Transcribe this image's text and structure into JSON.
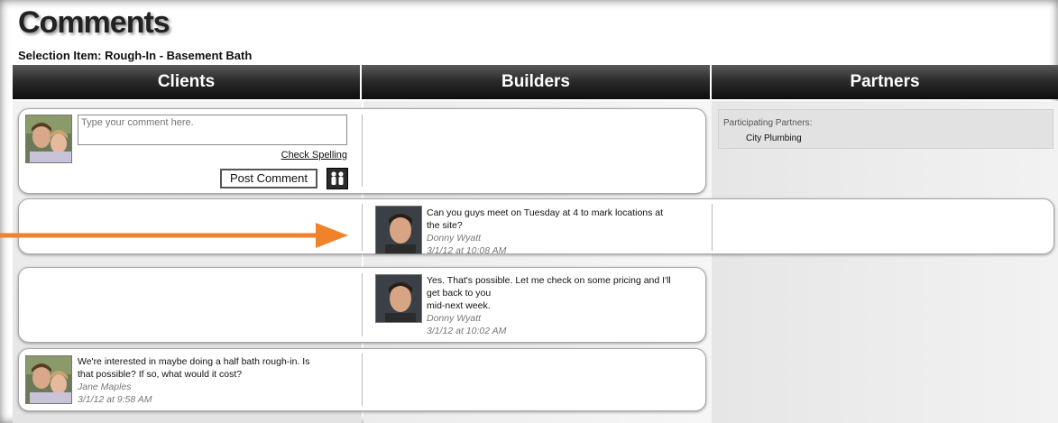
{
  "page": {
    "title": "Comments",
    "selection_item": "Selection Item: Rough-In - Basement Bath"
  },
  "columns": {
    "clients": "Clients",
    "builders": "Builders",
    "partners": "Partners"
  },
  "composer": {
    "placeholder": "Type your comment here.",
    "check_spelling": "Check Spelling",
    "post_comment": "Post Comment",
    "participants_icon": "people-icon"
  },
  "partners": {
    "label": "Participating Partners:",
    "names": [
      "City Plumbing"
    ]
  },
  "comments": [
    {
      "column": "builders",
      "text_lines": [
        "Can you guys meet on Tuesday at 4 to mark locations at",
        "the site?"
      ],
      "author": "Donny Wyatt",
      "timestamp": "3/1/12 at 10:08 AM"
    },
    {
      "column": "builders",
      "text_lines": [
        "Yes. That's possible. Let me check on some pricing and I'll",
        "get back to you",
        "mid-next week."
      ],
      "author": "Donny Wyatt",
      "timestamp": "3/1/12 at 10:02 AM"
    },
    {
      "column": "clients",
      "text_lines": [
        "We're interested in maybe doing a half bath rough-in. Is",
        "that possible? If so, what would it cost?"
      ],
      "author": "Jane Maples",
      "timestamp": "3/1/12 at 9:58 AM"
    }
  ],
  "colors": {
    "arrow": "#f0822a",
    "header_bg": "#1a1a1a"
  }
}
